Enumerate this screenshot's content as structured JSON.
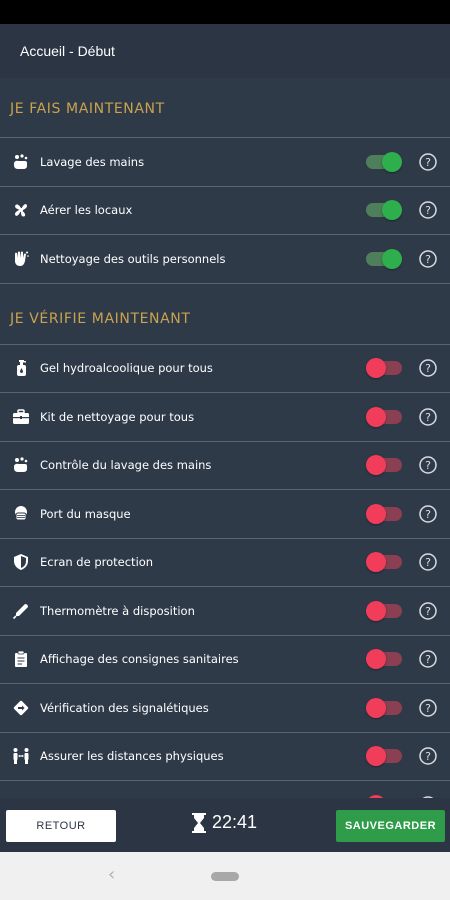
{
  "app_bar": {
    "title": "Accueil - Début"
  },
  "sections": [
    {
      "title": "JE FAIS MAINTENANT",
      "items": [
        {
          "label": "Lavage des mains",
          "icon": "hand-wash-icon",
          "enabled": true
        },
        {
          "label": "Aérer les locaux",
          "icon": "ventilation-icon",
          "enabled": true
        },
        {
          "label": "Nettoyage des outils personnels",
          "icon": "clean-hands-icon",
          "enabled": true
        }
      ]
    },
    {
      "title": "JE VÉRIFIE MAINTENANT",
      "items": [
        {
          "label": "Gel hydroalcoolique pour tous",
          "icon": "sanitizer-icon",
          "enabled": false
        },
        {
          "label": "Kit de nettoyage pour tous",
          "icon": "kit-icon",
          "enabled": false
        },
        {
          "label": "Contrôle du lavage des mains",
          "icon": "hand-wash-icon",
          "enabled": false
        },
        {
          "label": "Port du masque",
          "icon": "mask-icon",
          "enabled": false
        },
        {
          "label": "Ecran de protection",
          "icon": "shield-icon",
          "enabled": false
        },
        {
          "label": "Thermomètre à disposition",
          "icon": "thermometer-icon",
          "enabled": false
        },
        {
          "label": "Affichage des consignes sanitaires",
          "icon": "clipboard-icon",
          "enabled": false
        },
        {
          "label": "Vérification des signalétiques",
          "icon": "sign-icon",
          "enabled": false
        },
        {
          "label": "Assurer les distances physiques",
          "icon": "distance-icon",
          "enabled": false
        },
        {
          "label": "",
          "icon": "partial-icon",
          "enabled": false
        }
      ]
    }
  ],
  "bottom_bar": {
    "back_label": "RETOUR",
    "timer": "22:41",
    "save_label": "SAUVEGARDER"
  },
  "colors": {
    "background": "#2f3a49",
    "section_title": "#c9a24e",
    "toggle_on": "#2fae4e",
    "toggle_off": "#f23d5a",
    "save_button": "#2e9c48"
  }
}
